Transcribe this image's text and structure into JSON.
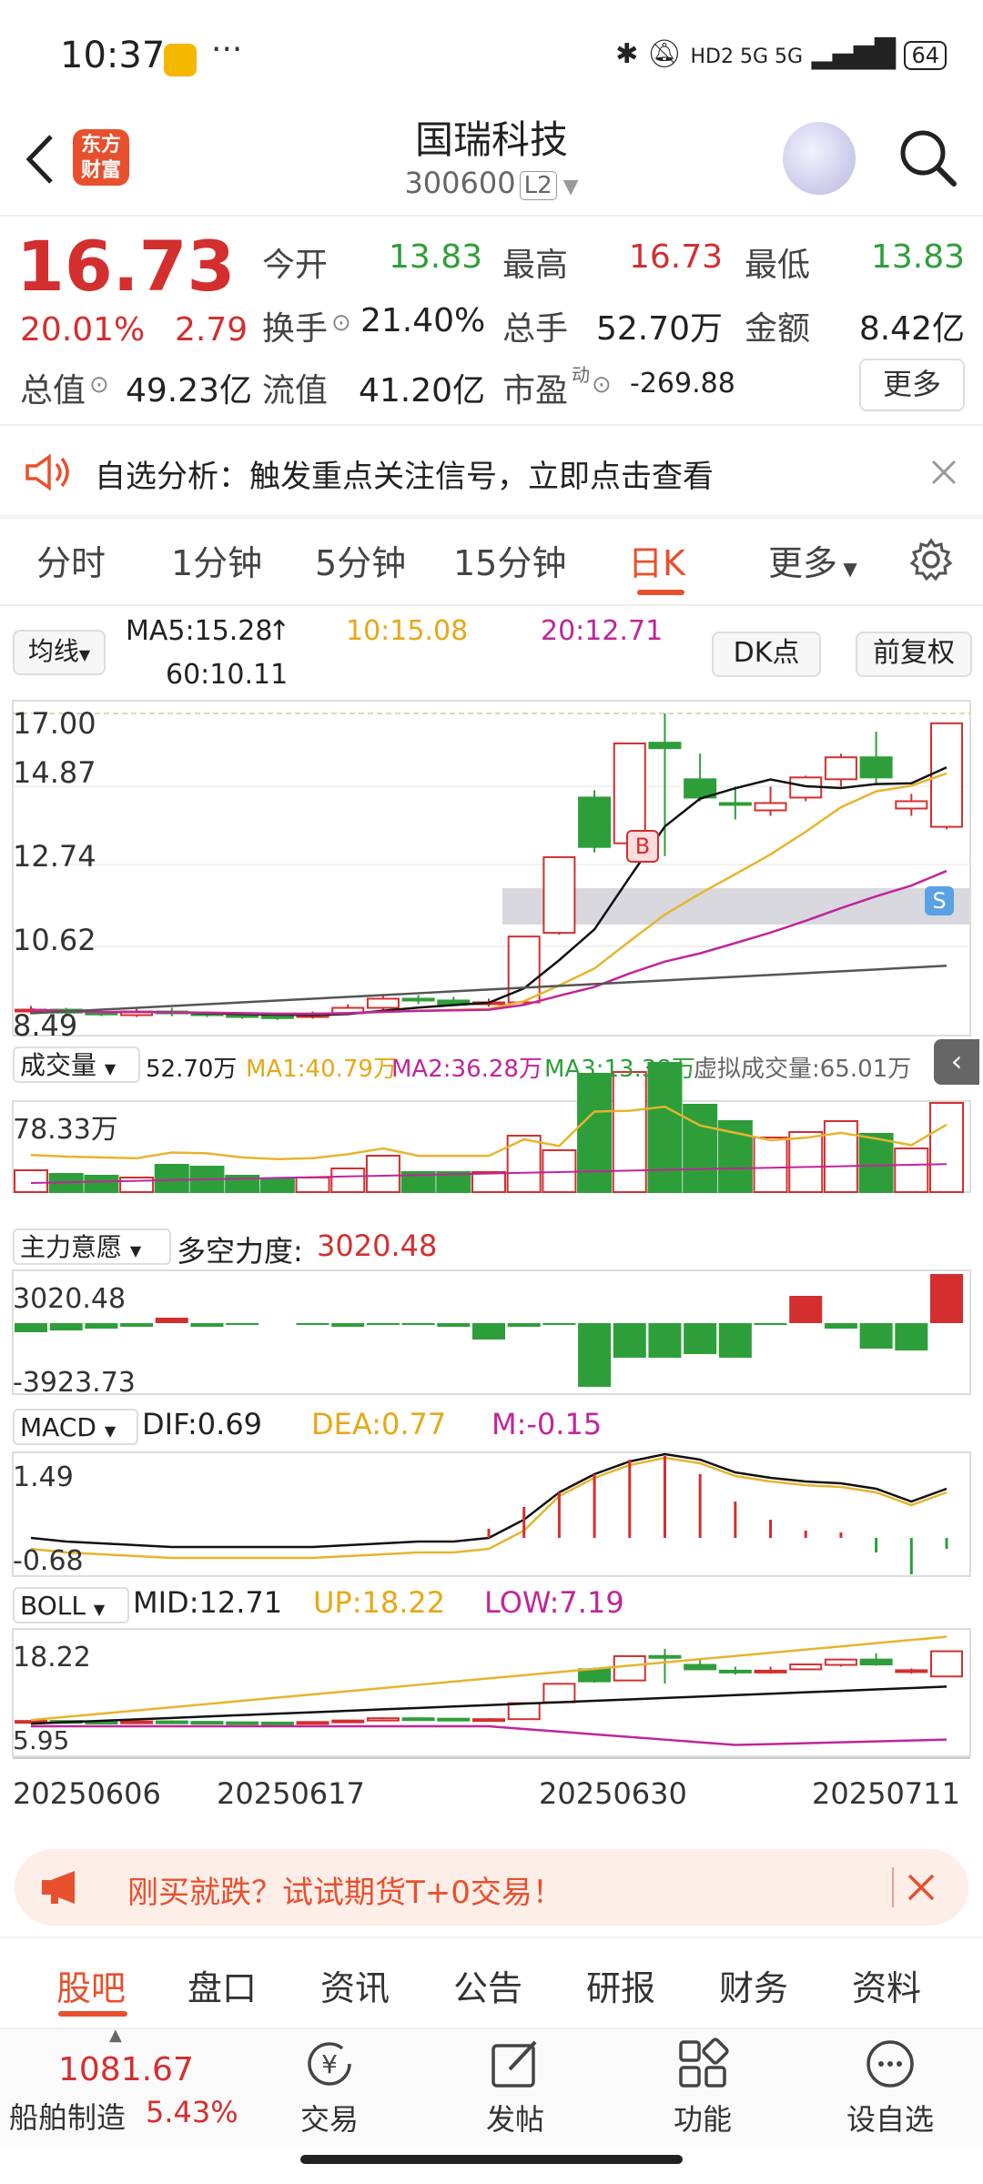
{
  "status_bar": {
    "time": "10:37",
    "network": "HD2 5G 5G",
    "battery": "64"
  },
  "header": {
    "logo": "东方\n财富",
    "name": "国瑞科技",
    "code": "300600",
    "level": "L2"
  },
  "quote": {
    "price": "16.73",
    "pct": "20.01%",
    "change": "2.79",
    "open_label": "今开",
    "open": "13.83",
    "high_label": "最高",
    "high": "16.73",
    "low_label": "最低",
    "low": "13.83",
    "turnover_label": "换手",
    "turnover": "21.40%",
    "volume_label": "总手",
    "volume": "52.70万",
    "amount_label": "金额",
    "amount": "8.42亿",
    "mktcap_label": "总值",
    "mktcap": "49.23亿",
    "float_label": "流值",
    "float": "41.20亿",
    "pe_label": "市盈",
    "pe_sup": "动",
    "pe": "-269.88",
    "more": "更多"
  },
  "alert": {
    "text": "自选分析：触发重点关注信号，立即点击查看"
  },
  "period_tabs": [
    "分时",
    "1分钟",
    "5分钟",
    "15分钟",
    "日K",
    "更多"
  ],
  "ma_legend": {
    "selector": "均线",
    "ma5": "MA5:15.28",
    "ma10": "10:15.08",
    "ma20": "20:12.71",
    "ma60": "60:10.11",
    "dk": "DK点",
    "adj": "前复权"
  },
  "kline_axis": [
    "17.00",
    "14.87",
    "12.74",
    "10.62",
    "8.49"
  ],
  "volume_legend": {
    "selector": "成交量",
    "vol": "52.70万",
    "ma1": "MA1:40.79万",
    "ma2": "MA2:36.28万",
    "ma3": "MA3:13.38万",
    "virtual": "虚拟成交量:65.01万",
    "axis_top": "78.33万"
  },
  "force_legend": {
    "selector": "主力意愿",
    "label": "多空力度:",
    "value": "3020.48",
    "axis_top": "3020.48",
    "axis_bottom": "-3923.73"
  },
  "macd_legend": {
    "selector": "MACD",
    "dif": "DIF:0.69",
    "dea": "DEA:0.77",
    "m": "M:-0.15",
    "axis_top": "1.49",
    "axis_bottom": "-0.68"
  },
  "boll_legend": {
    "selector": "BOLL",
    "mid": "MID:12.71",
    "up": "UP:18.22",
    "low": "LOW:7.19",
    "axis_top": "18.22",
    "axis_bottom": "5.95"
  },
  "dates": [
    "20250606",
    "20250617",
    "20250630",
    "20250711"
  ],
  "markers": {
    "buy": "B",
    "sell": "S"
  },
  "ad": {
    "text": "刚买就跌？试试期货T+0交易！"
  },
  "bottom_tabs": [
    "股吧",
    "盘口",
    "资讯",
    "公告",
    "研报",
    "财务",
    "资料"
  ],
  "toolbar": {
    "index_value": "1081.67",
    "index_name": "船舶制造",
    "index_pct": "5.43%",
    "trade": "交易",
    "post": "发帖",
    "func": "功能",
    "watch": "设自选"
  },
  "colors": {
    "up": "#d32f2f",
    "down": "#2e9e3a",
    "accent": "#e8502d",
    "ma10": "#e6b42e",
    "ma20": "#c0259a"
  },
  "chart_data": {
    "type": "candlestick",
    "dates_shown": [
      "20250606",
      "20250617",
      "20250630",
      "20250711"
    ],
    "candles": [
      {
        "o": 8.85,
        "c": 8.9,
        "h": 9.0,
        "l": 8.78
      },
      {
        "o": 8.9,
        "c": 8.82,
        "h": 8.95,
        "l": 8.75
      },
      {
        "o": 8.82,
        "c": 8.78,
        "h": 8.88,
        "l": 8.72
      },
      {
        "o": 8.75,
        "c": 8.85,
        "h": 8.92,
        "l": 8.7
      },
      {
        "o": 8.85,
        "c": 8.8,
        "h": 8.95,
        "l": 8.72
      },
      {
        "o": 8.8,
        "c": 8.75,
        "h": 8.85,
        "l": 8.7
      },
      {
        "o": 8.75,
        "c": 8.72,
        "h": 8.8,
        "l": 8.65
      },
      {
        "o": 8.72,
        "c": 8.7,
        "h": 8.8,
        "l": 8.62
      },
      {
        "o": 8.7,
        "c": 8.78,
        "h": 8.85,
        "l": 8.65
      },
      {
        "o": 8.8,
        "c": 8.95,
        "h": 9.05,
        "l": 8.75
      },
      {
        "o": 8.95,
        "c": 9.2,
        "h": 9.3,
        "l": 8.9
      },
      {
        "o": 9.2,
        "c": 9.15,
        "h": 9.3,
        "l": 9.05
      },
      {
        "o": 9.15,
        "c": 9.05,
        "h": 9.25,
        "l": 9.0
      },
      {
        "o": 9.05,
        "c": 9.1,
        "h": 9.2,
        "l": 8.98
      },
      {
        "o": 9.1,
        "c": 10.9,
        "h": 10.9,
        "l": 9.05
      },
      {
        "o": 11.0,
        "c": 13.07,
        "h": 13.07,
        "l": 10.95
      },
      {
        "o": 14.7,
        "c": 13.35,
        "h": 14.9,
        "l": 13.2
      },
      {
        "o": 13.45,
        "c": 16.18,
        "h": 16.18,
        "l": 13.4
      },
      {
        "o": 16.2,
        "c": 16.05,
        "h": 17.0,
        "l": 13.1
      },
      {
        "o": 15.2,
        "c": 14.7,
        "h": 15.9,
        "l": 14.6
      },
      {
        "o": 14.55,
        "c": 14.5,
        "h": 15.0,
        "l": 14.1
      },
      {
        "o": 14.35,
        "c": 14.55,
        "h": 15.0,
        "l": 14.2
      },
      {
        "o": 14.7,
        "c": 15.25,
        "h": 15.3,
        "l": 14.6
      },
      {
        "o": 15.2,
        "c": 15.8,
        "h": 15.9,
        "l": 15.0
      },
      {
        "o": 15.8,
        "c": 15.25,
        "h": 16.5,
        "l": 15.1
      },
      {
        "o": 14.4,
        "c": 14.6,
        "h": 14.8,
        "l": 14.2
      },
      {
        "o": 13.9,
        "c": 16.73,
        "h": 16.73,
        "l": 13.83
      }
    ],
    "ma": {
      "MA5": 15.28,
      "MA10": 15.08,
      "MA20": 12.71,
      "MA60": 10.11
    },
    "y_range": [
      8.49,
      17.0
    ]
  }
}
